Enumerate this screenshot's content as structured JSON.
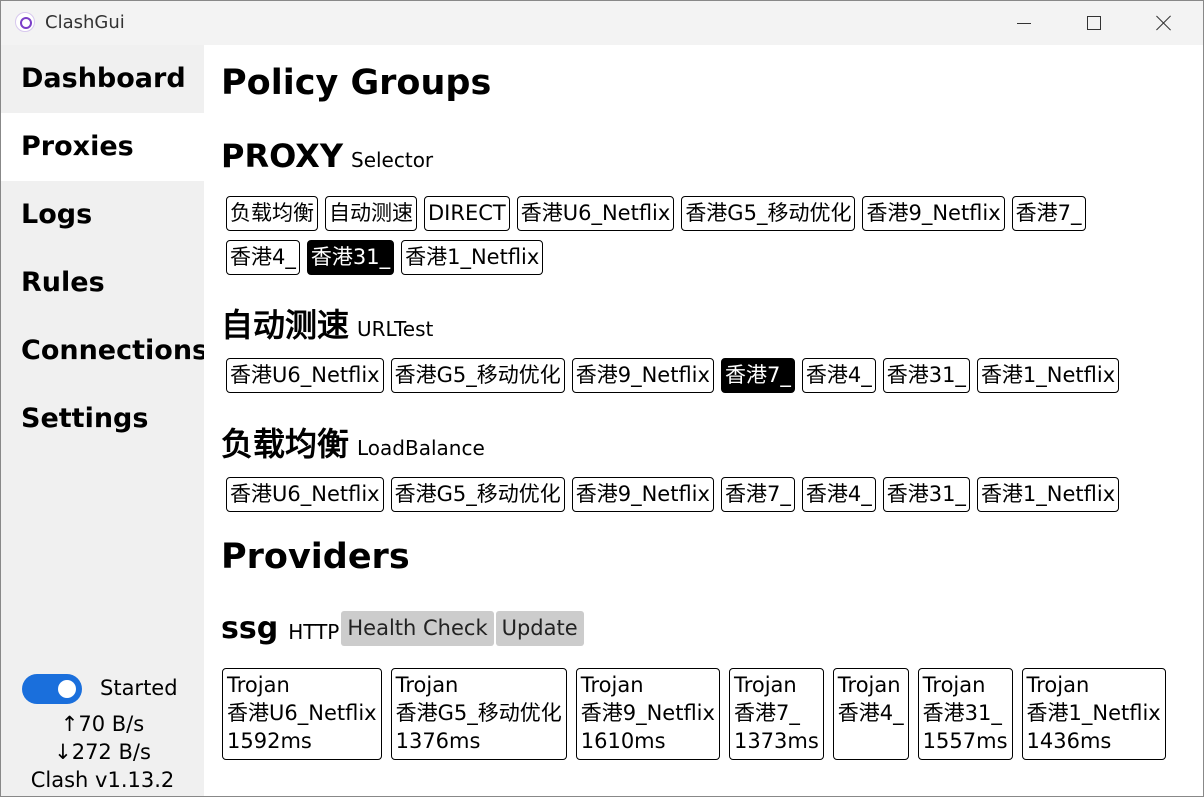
{
  "window": {
    "title": "ClashGui",
    "app_icon": "clash-logo-icon",
    "controls": [
      "minimize-icon",
      "maximize-icon",
      "close-icon"
    ]
  },
  "sidebar": {
    "items": [
      {
        "label": "Dashboard",
        "active": false
      },
      {
        "label": "Proxies",
        "active": true
      },
      {
        "label": "Logs",
        "active": false
      },
      {
        "label": "Rules",
        "active": false
      },
      {
        "label": "Connections",
        "active": false
      },
      {
        "label": "Settings",
        "active": false
      }
    ],
    "status_label": "Started",
    "toggle_on": true,
    "upload": "↑70 B/s",
    "download": "↓272 B/s",
    "version": "Clash v1.13.2"
  },
  "main": {
    "policy_title": "Policy Groups",
    "groups": [
      {
        "name": "PROXY",
        "type": "Selector",
        "options": [
          "负载均衡",
          "自动测速",
          "DIRECT",
          "香港U6_Netflix",
          "香港G5_移动优化",
          "香港9_Netflix",
          "香港7_",
          "香港4_",
          "香港31_",
          "香港1_Netflix"
        ],
        "selected": "香港31_"
      },
      {
        "name": "自动测速",
        "type": "URLTest",
        "options": [
          "香港U6_Netflix",
          "香港G5_移动优化",
          "香港9_Netflix",
          "香港7_",
          "香港4_",
          "香港31_",
          "香港1_Netflix"
        ],
        "selected": "香港7_"
      },
      {
        "name": "负载均衡",
        "type": "LoadBalance",
        "options": [
          "香港U6_Netflix",
          "香港G5_移动优化",
          "香港9_Netflix",
          "香港7_",
          "香港4_",
          "香港31_",
          "香港1_Netflix"
        ],
        "selected": ""
      }
    ],
    "providers_title": "Providers",
    "provider": {
      "name": "ssg",
      "type": "HTTP",
      "health_check_label": "Health Check",
      "update_label": "Update",
      "nodes": [
        {
          "protocol": "Trojan",
          "name": "香港U6_Netflix",
          "latency": "1592ms"
        },
        {
          "protocol": "Trojan",
          "name": "香港G5_移动优化",
          "latency": "1376ms"
        },
        {
          "protocol": "Trojan",
          "name": "香港9_Netflix",
          "latency": "1610ms"
        },
        {
          "protocol": "Trojan",
          "name": "香港7_",
          "latency": "1373ms"
        },
        {
          "protocol": "Trojan",
          "name": "香港4_",
          "latency": ""
        },
        {
          "protocol": "Trojan",
          "name": "香港31_",
          "latency": "1557ms"
        },
        {
          "protocol": "Trojan",
          "name": "香港1_Netflix",
          "latency": "1436ms"
        }
      ]
    }
  }
}
